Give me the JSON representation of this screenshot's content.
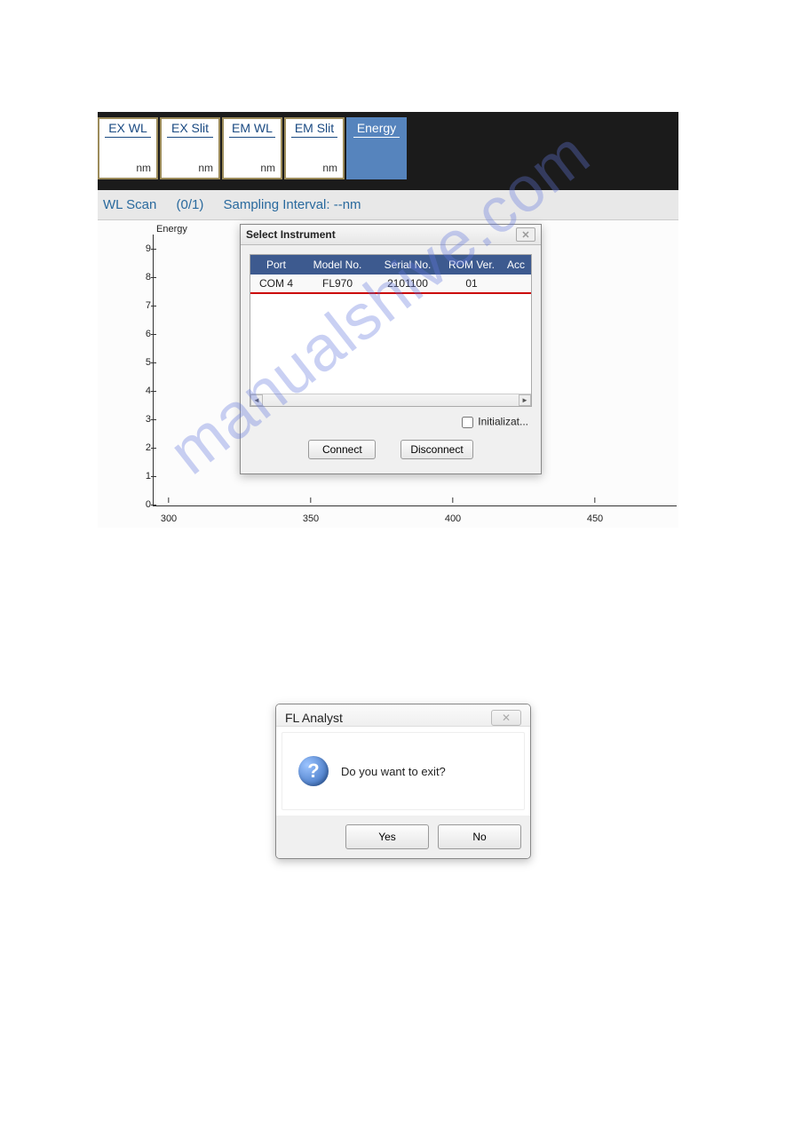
{
  "tiles": [
    {
      "title": "EX WL",
      "unit": "nm"
    },
    {
      "title": "EX Slit",
      "unit": "nm"
    },
    {
      "title": "EM WL",
      "unit": "nm"
    },
    {
      "title": "EM Slit",
      "unit": "nm"
    },
    {
      "title": "Energy",
      "unit": ""
    }
  ],
  "subbar": {
    "mode": "WL Scan",
    "progress": "(0/1)",
    "sampling": "Sampling Interval: --nm"
  },
  "chart_data": {
    "type": "line",
    "title": "",
    "xlabel": "",
    "ylabel": "Energy",
    "x_ticks": [
      300,
      350,
      400,
      450
    ],
    "y_ticks": [
      0,
      1,
      2,
      3,
      4,
      5,
      6,
      7,
      8,
      9
    ],
    "xlim": [
      300,
      460
    ],
    "ylim": [
      0,
      9.5
    ],
    "series": []
  },
  "sel_dialog": {
    "title": "Select Instrument",
    "headers": [
      "Port",
      "Model No.",
      "Serial No.",
      "ROM Ver.",
      "Acc"
    ],
    "rows": [
      {
        "port": "COM 4",
        "model": "FL970",
        "serial": "2101100",
        "rom": "01",
        "acc": ""
      }
    ],
    "initialize_label": "Initializat...",
    "initialize_checked": false,
    "connect": "Connect",
    "disconnect": "Disconnect"
  },
  "exit_dialog": {
    "title": "FL Analyst",
    "message": "Do you want to exit?",
    "yes": "Yes",
    "no": "No"
  },
  "watermark": "manualshive.com"
}
